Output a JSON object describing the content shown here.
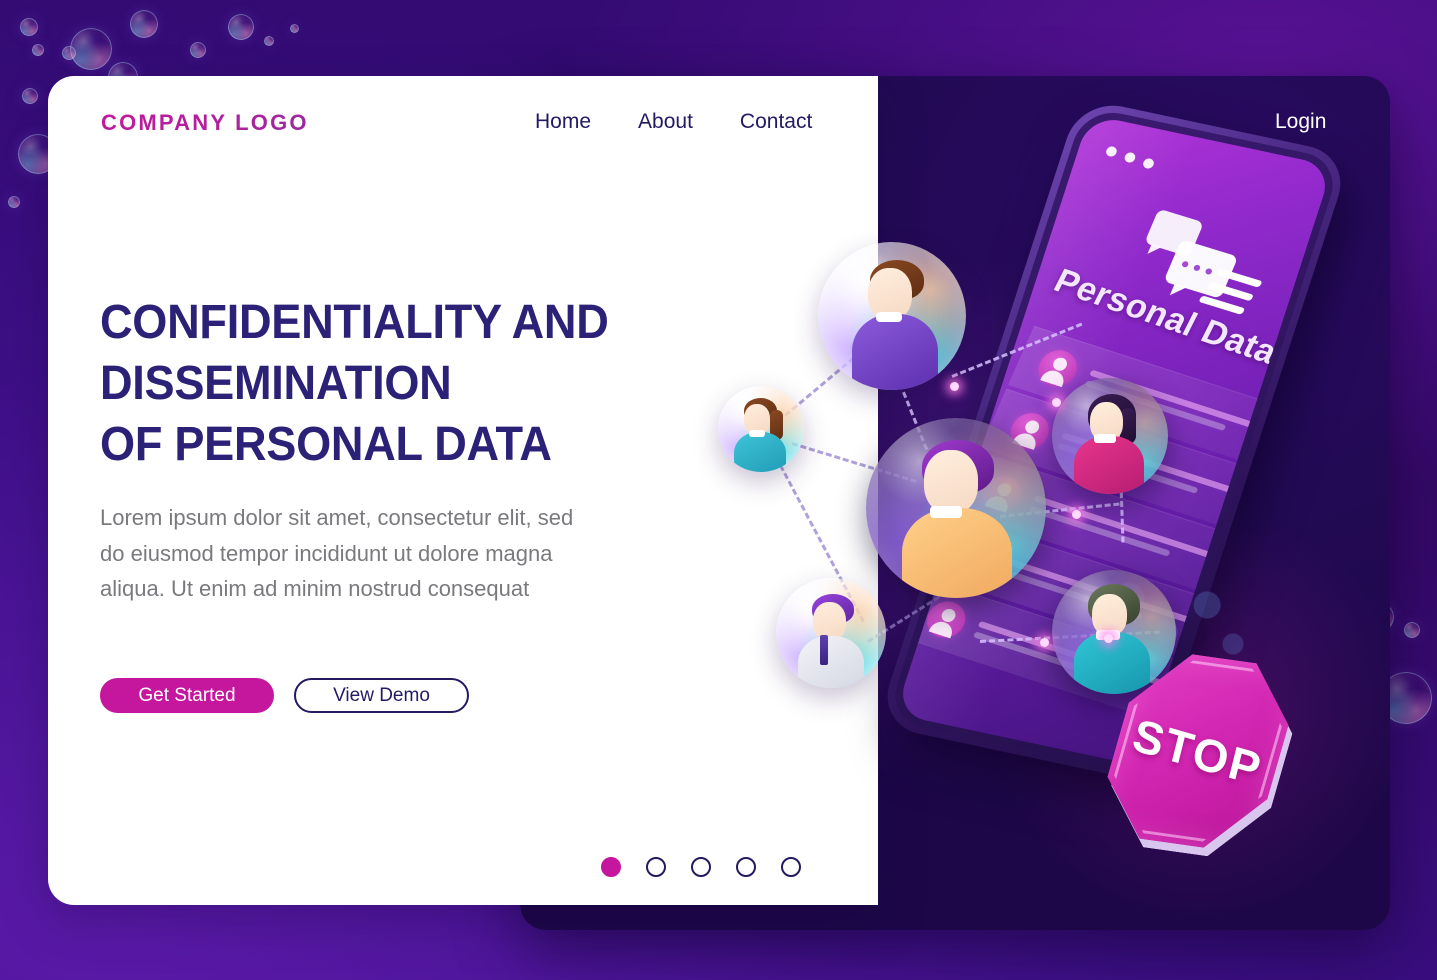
{
  "header": {
    "logo": "COMPANY LOGO",
    "nav": [
      {
        "label": "Home"
      },
      {
        "label": "About"
      },
      {
        "label": "Contact"
      }
    ],
    "login": "Login"
  },
  "hero": {
    "headline_line1": "CONFIDENTIALITY AND",
    "headline_line2": "DISSEMINATION",
    "headline_line3": "OF PERSONAL DATA",
    "paragraph": "Lorem ipsum dolor sit amet, consectetur elit, sed do eiusmod tempor incididunt ut dolore magna aliqua. Ut enim ad minim nostrud consequat",
    "primary_button": "Get Started",
    "secondary_button": "View Demo"
  },
  "carousel": {
    "slides": [
      {
        "active": true
      },
      {
        "active": false
      },
      {
        "active": false
      },
      {
        "active": false
      },
      {
        "active": false
      }
    ]
  },
  "phone": {
    "screen_title": "Personal Data",
    "status_dots": 3,
    "chat_icon": "chat-bubbles-icon",
    "menu_icon": "hamburger-menu-icon",
    "list_rows": [
      {
        "avatar": "person-icon",
        "blob": "orange"
      },
      {
        "avatar": "person-icon",
        "blob": "none"
      },
      {
        "avatar": "person-icon",
        "blob": "blue"
      },
      {
        "avatar": "person-icon",
        "blob": "orange"
      },
      {
        "avatar": "person-icon",
        "blob": "none"
      }
    ]
  },
  "stop_sign": {
    "label": "STOP",
    "shape": "octagon"
  },
  "network": {
    "nodes": [
      {
        "id": "node-male-brown-hair",
        "size": "large"
      },
      {
        "id": "node-female-ponytail",
        "size": "small"
      },
      {
        "id": "node-person-orange-shirt",
        "size": "xlarge"
      },
      {
        "id": "node-male-tie",
        "size": "medium"
      },
      {
        "id": "node-female-pink-shirt",
        "size": "medium"
      },
      {
        "id": "node-person-teal-shirt",
        "size": "medium"
      }
    ]
  },
  "colors": {
    "accent_magenta": "#c4179e",
    "headline_navy": "#2b2277",
    "nav_navy": "#231a62",
    "body_gray": "#7a7a7e",
    "background_purple": "#4a1496",
    "panel_dark": "#240a57",
    "screen_purple": "#9129cc"
  }
}
